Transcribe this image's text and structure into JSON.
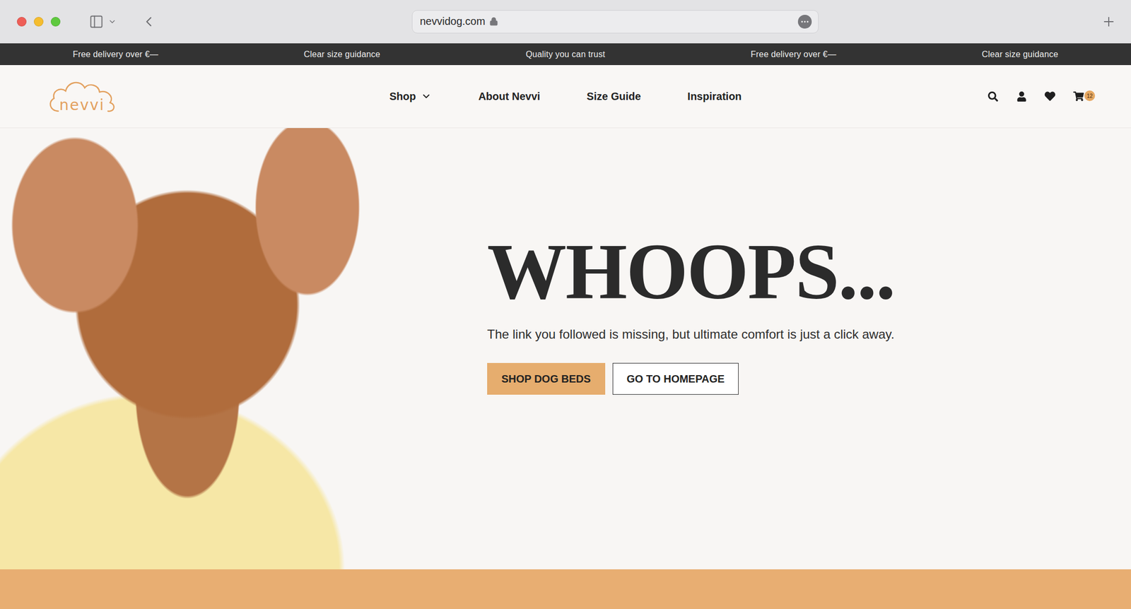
{
  "browser": {
    "url": "nevvidog.com"
  },
  "announcements": [
    "Free delivery over €—",
    "Clear size guidance",
    "Quality you can trust",
    "Free delivery over €—",
    "Clear size guidance"
  ],
  "logo": "nevvi",
  "nav": [
    {
      "label": "Shop",
      "has_dropdown": true
    },
    {
      "label": "About Nevvi",
      "has_dropdown": false
    },
    {
      "label": "Size Guide",
      "has_dropdown": false
    },
    {
      "label": "Inspiration",
      "has_dropdown": false
    }
  ],
  "cart": {
    "count": "12"
  },
  "hero": {
    "title": "WHOOPS...",
    "message": "The link you followed is missing, but ultimate comfort is just a click away.",
    "buttons": [
      {
        "label": "SHOP DOG BEDS",
        "kind": "primary"
      },
      {
        "label": "GO TO HOMEPAGE",
        "kind": "secondary"
      }
    ]
  }
}
